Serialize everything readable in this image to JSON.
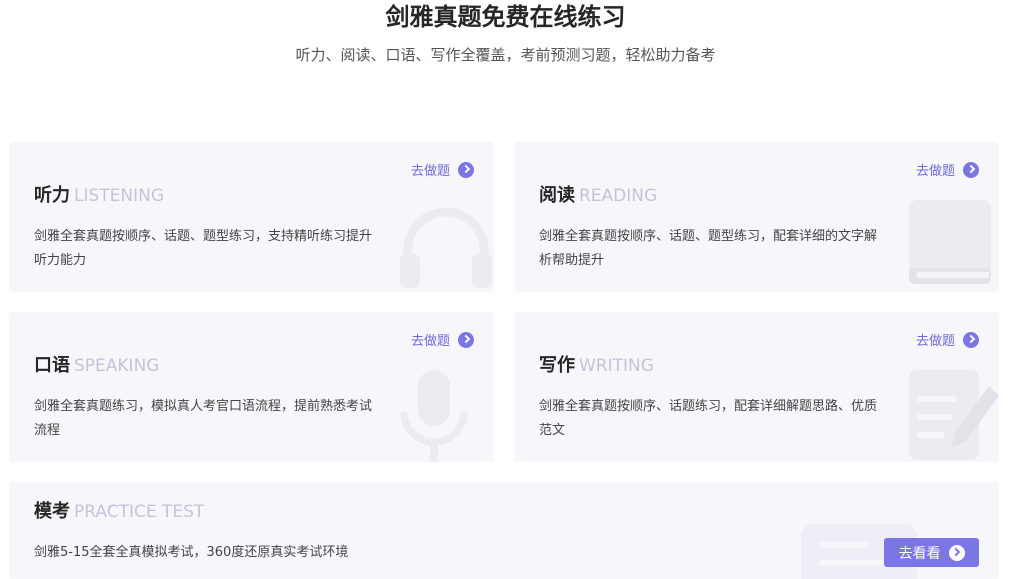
{
  "header": {
    "title": "剑雅真题免费在线练习",
    "subtitle": "听力、阅读、口语、写作全覆盖，考前预测习题，轻松助力备考"
  },
  "cards": {
    "listening": {
      "cn": "听力",
      "en": "LISTENING",
      "desc": "剑雅全套真题按顺序、话题、题型练习，支持精听练习提升听力能力",
      "action": "去做题",
      "icon": "headphones-icon"
    },
    "reading": {
      "cn": "阅读",
      "en": "READING",
      "desc": "剑雅全套真题按顺序、话题、题型练习，配套详细的文字解析帮助提升",
      "action": "去做题",
      "icon": "book-icon"
    },
    "speaking": {
      "cn": "口语",
      "en": "SPEAKING",
      "desc": "剑雅全套真题练习，模拟真人考官口语流程，提前熟悉考试流程",
      "action": "去做题",
      "icon": "microphone-icon"
    },
    "writing": {
      "cn": "写作",
      "en": "WRITING",
      "desc": "剑雅全套真题按顺序、话题练习，配套详细解题思路、优质范文",
      "action": "去做题",
      "icon": "pencil-paper-icon"
    },
    "mock": {
      "cn": "模考",
      "en": "PRACTICE TEST",
      "desc": "剑雅5-15全套全真模拟考试，360度还原真实考试环境",
      "action": "去看看",
      "icon": "document-icon"
    }
  },
  "colors": {
    "accent": "#7b76e6",
    "card_bg": "#f7f7fb",
    "en_label": "#c4c4d6"
  }
}
